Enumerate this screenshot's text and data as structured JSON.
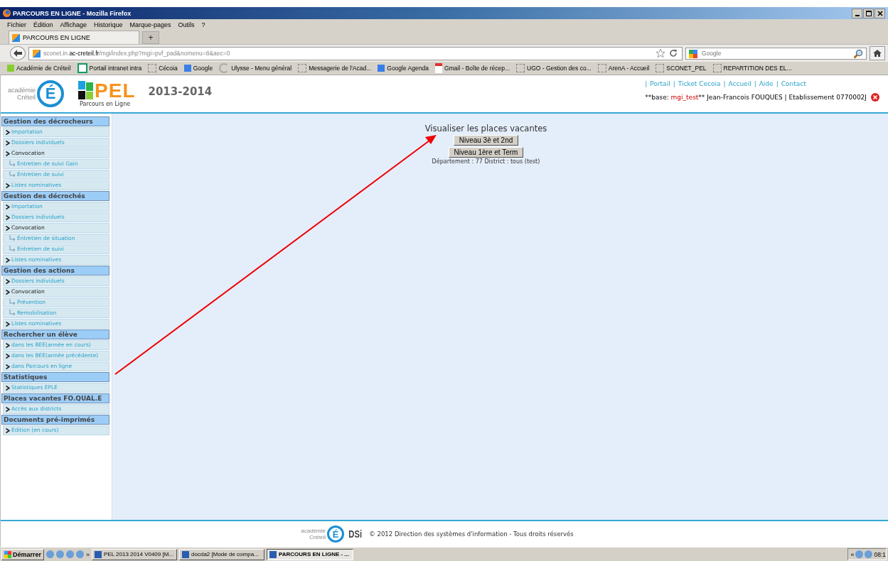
{
  "window": {
    "title": "PARCOURS EN LIGNE - Mozilla Firefox"
  },
  "menu": [
    "Fichier",
    "Édition",
    "Affichage",
    "Historique",
    "Marque-pages",
    "Outils",
    "?"
  ],
  "tabs": [
    {
      "label": "PARCOURS EN LIGNE",
      "selected": true
    }
  ],
  "new_tab": "+",
  "address": {
    "prefix": "sconet.in.",
    "domain": "ac-creteil.fr",
    "path": "/mgi/index.php?mgi=pvf_pad&nomenu=8&aec=0"
  },
  "search": {
    "placeholder": "Google"
  },
  "bookmarks": [
    {
      "label": "Académie de Créteil",
      "kind": "site"
    },
    {
      "label": "Portail intranet intra",
      "kind": "e"
    },
    {
      "label": "Cécoia",
      "kind": "blank"
    },
    {
      "label": "Google",
      "kind": "g"
    },
    {
      "label": "Ulysse - Menu général",
      "kind": "c"
    },
    {
      "label": "Messagerie de l'Acad...",
      "kind": "blank"
    },
    {
      "label": "Google Agenda",
      "kind": "cal"
    },
    {
      "label": "Gmail - Boîte de récep...",
      "kind": "m"
    },
    {
      "label": "UGO - Gestion des co...",
      "kind": "blank"
    },
    {
      "label": "ArenA - Accueil",
      "kind": "blank"
    },
    {
      "label": "SCONET_PEL",
      "kind": "blank"
    },
    {
      "label": "REPARTITION DES EL...",
      "kind": "blank"
    }
  ],
  "header": {
    "logo_top": "académie",
    "logo_bottom": "Créteil",
    "logo_letter": "É",
    "app_logo": "PEL",
    "app_tagline": "Parcours en Ligne",
    "year": "2013-2014",
    "link_separator": "|",
    "links": [
      "Portail",
      "Ticket Cecoia",
      "Accueil",
      "Aide",
      "Contact"
    ],
    "user_prefix": "**base:",
    "user_base": "mgi_test",
    "user_rest": "** Jean-Francois FOUQUES | Etablissement 0770002J"
  },
  "sidebar": {
    "items": [
      {
        "label": "Gestion des décrocheurs",
        "kind": "section"
      },
      {
        "label": "Importation",
        "kind": "link"
      },
      {
        "label": "Dossiers individuels",
        "kind": "link"
      },
      {
        "label": "Convocation",
        "kind": "label"
      },
      {
        "label": "Entretien de suivi Gain",
        "kind": "sub"
      },
      {
        "label": "Entretien de suivi",
        "kind": "sub"
      },
      {
        "label": "Listes nominatives",
        "kind": "link"
      },
      {
        "label": "Gestion des décrochés",
        "kind": "section"
      },
      {
        "label": "Importation",
        "kind": "link"
      },
      {
        "label": "Dossiers individuels",
        "kind": "link"
      },
      {
        "label": "Convocation",
        "kind": "label"
      },
      {
        "label": "Entretien de situation",
        "kind": "sub"
      },
      {
        "label": "Entretien de suivi",
        "kind": "sub"
      },
      {
        "label": "Listes nominatives",
        "kind": "link"
      },
      {
        "label": "Gestion des actions",
        "kind": "section"
      },
      {
        "label": "Dossiers individuels",
        "kind": "link"
      },
      {
        "label": "Convocation",
        "kind": "label"
      },
      {
        "label": "Prévention",
        "kind": "sub"
      },
      {
        "label": "Remobilisation",
        "kind": "sub"
      },
      {
        "label": "Listes nominatives",
        "kind": "link"
      },
      {
        "label": "Rechercher un élève",
        "kind": "section"
      },
      {
        "label": "dans les BEE(année en cours)",
        "kind": "link"
      },
      {
        "label": "dans les BEE(année précédente)",
        "kind": "link"
      },
      {
        "label": "dans Parcours en ligne",
        "kind": "link"
      },
      {
        "label": "Statistiques",
        "kind": "section"
      },
      {
        "label": "Statistiques EPLE",
        "kind": "link"
      },
      {
        "label": "Places vacantes FO.QUAL.E",
        "kind": "section"
      },
      {
        "label": "Accès aux districts",
        "kind": "link"
      },
      {
        "label": "Documents pré-imprimés",
        "kind": "section"
      },
      {
        "label": "Edition (en cours)",
        "kind": "link"
      }
    ]
  },
  "main": {
    "title": "Visualiser les places vacantes",
    "buttons": [
      "Niveau 3è et 2nd",
      "Niveau 1ère et Term"
    ],
    "info": "Département : 77  District : tous (test)"
  },
  "footer": {
    "logo_top": "académie",
    "logo_bottom": "Créteil",
    "logo_letter": "É",
    "dsi": "DSi",
    "copyright": "© 2012 Direction des systèmes d'information - Tous droits réservés"
  },
  "taskbar": {
    "start": "Démarrer",
    "more": "»",
    "tasks": [
      {
        "label": "PEL 2013 2014 V0409 [M...",
        "selected": false
      },
      {
        "label": "docda2 [Mode de compa...",
        "selected": false
      },
      {
        "label": "PARCOURS EN LIGNE - ...",
        "selected": true
      }
    ],
    "tray_expand": "«",
    "clock": "08:1"
  }
}
